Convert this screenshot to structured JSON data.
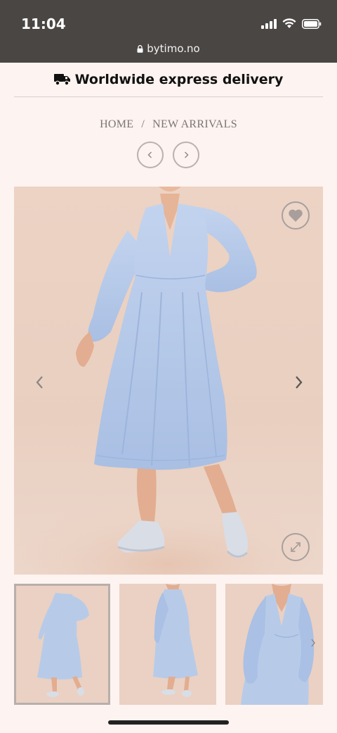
{
  "status_bar": {
    "time": "11:04",
    "url": "bytimo.no"
  },
  "banner": {
    "text": "Worldwide express delivery",
    "icon": "truck-icon"
  },
  "breadcrumb": {
    "home": "HOME",
    "separator": "/",
    "current": "NEW ARRIVALS"
  },
  "product_nav": {
    "prev_icon": "chevron-left-icon",
    "next_icon": "chevron-right-icon"
  },
  "gallery": {
    "favorite_icon": "heart-icon",
    "zoom_icon": "expand-icon",
    "thumbnail_count": 3,
    "active_thumbnail": 1
  },
  "colors": {
    "background": "#fdf3f0",
    "status_bar": "#4a4644",
    "dress": "#b7cbe9"
  }
}
